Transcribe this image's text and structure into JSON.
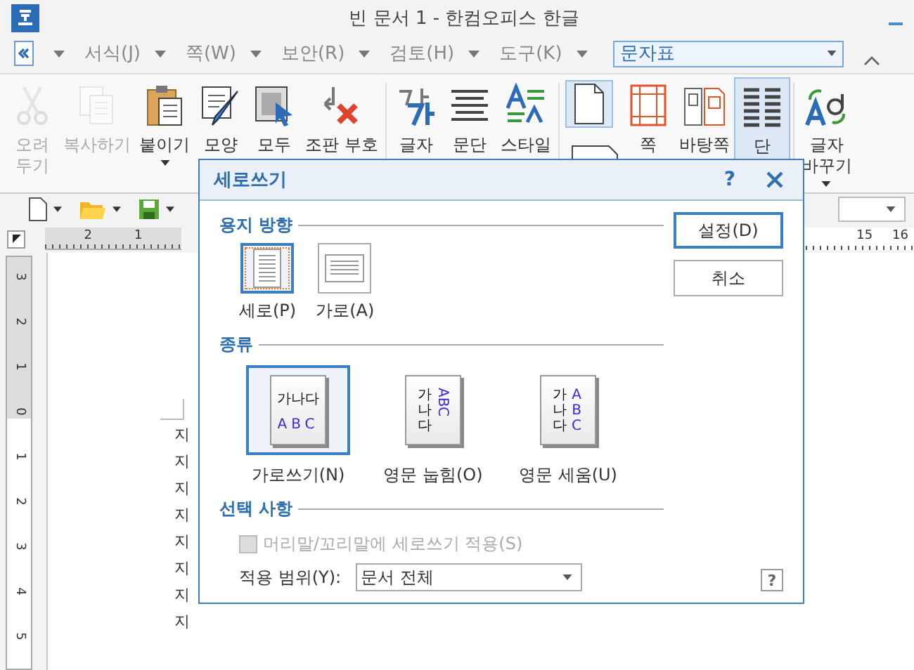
{
  "window": {
    "title": "빈 문서 1 - 한컴오피스 한글"
  },
  "menu": {
    "items": [
      "서식(J)",
      "쪽(W)",
      "보안(R)",
      "검토(H)",
      "도구(K)"
    ],
    "combo": "문자표"
  },
  "ribbon": {
    "groups": [
      {
        "items": [
          {
            "kind": "scissors",
            "lines": [
              "오려",
              "두기"
            ],
            "disabled": true,
            "selected": false,
            "dropdown": false
          },
          {
            "kind": "copy",
            "lines": [
              "복사하기"
            ],
            "disabled": true,
            "selected": false,
            "dropdown": false
          },
          {
            "kind": "paste",
            "lines": [
              "붙이기"
            ],
            "disabled": false,
            "selected": false,
            "dropdown": true
          },
          {
            "kind": "brush",
            "lines": [
              "모양"
            ],
            "disabled": false,
            "selected": false
          },
          {
            "kind": "select",
            "lines": [
              "모두"
            ],
            "disabled": false,
            "selected": false
          },
          {
            "kind": "clear",
            "lines": [
              "조판 부호"
            ],
            "disabled": false,
            "selected": false
          }
        ]
      },
      {
        "items": [
          {
            "kind": "charshape",
            "lines": [
              "글자"
            ],
            "disabled": false,
            "selected": false
          },
          {
            "kind": "parashape",
            "lines": [
              "문단"
            ],
            "disabled": false,
            "selected": false
          },
          {
            "kind": "style",
            "lines": [
              "스타일"
            ],
            "disabled": false,
            "selected": false
          }
        ]
      },
      {
        "items": [
          {
            "kind": "orientation",
            "selected": true
          },
          {
            "kind": "margins",
            "lines": [
              "쪽"
            ],
            "disabled": false,
            "selected": false
          },
          {
            "kind": "masterpage",
            "lines": [
              "바탕쪽"
            ],
            "disabled": false,
            "selected": false
          },
          {
            "kind": "columns",
            "lines": [
              "단"
            ],
            "disabled": false,
            "selected": true
          }
        ]
      },
      {
        "items": [
          {
            "kind": "replace",
            "lines": [
              "글자",
              "바꾸기"
            ],
            "disabled": false,
            "selected": false,
            "dropdown": true
          }
        ]
      }
    ]
  },
  "ruler": {
    "left_numbers": [
      "2",
      "1"
    ],
    "right_numbers": [
      "15",
      "16"
    ],
    "vertical_numbers": [
      "3",
      "2",
      "1",
      "0",
      "1",
      "2",
      "3",
      "4",
      "5"
    ]
  },
  "document": {
    "lines": [
      "지",
      "지",
      "지",
      "지",
      "지",
      "지",
      "지",
      "지"
    ]
  },
  "dialog": {
    "title": "세로쓰기",
    "help": "?",
    "orientation": {
      "title": "용지 방향",
      "options": [
        {
          "kind": "portrait",
          "label": "세로(P)",
          "selected": true
        },
        {
          "kind": "landscape",
          "label": "가로(A)",
          "selected": false
        }
      ]
    },
    "type": {
      "title": "종류",
      "options": [
        {
          "kind": "horizontal",
          "label": "가로쓰기(N)",
          "hangul": "가나다",
          "latin": "ABC",
          "selected": true
        },
        {
          "kind": "rotated",
          "label": "영문 눕힘(O)",
          "hangul": "가나다",
          "latin": "ABC",
          "selected": false
        },
        {
          "kind": "upright",
          "label": "영문 세움(U)",
          "hangul": "가나다",
          "latin": "ABC",
          "selected": false
        }
      ]
    },
    "options": {
      "title": "선택 사항",
      "checkbox": {
        "label": "머리말/꼬리말에 세로쓰기 적용(S)",
        "checked": false,
        "disabled": true
      },
      "scope": {
        "label": "적용 범위(Y):",
        "value": "문서 전체"
      }
    },
    "buttons": [
      {
        "label": "설정(D)",
        "default": true
      },
      {
        "label": "취소",
        "default": false
      }
    ],
    "corner_help": "?"
  }
}
